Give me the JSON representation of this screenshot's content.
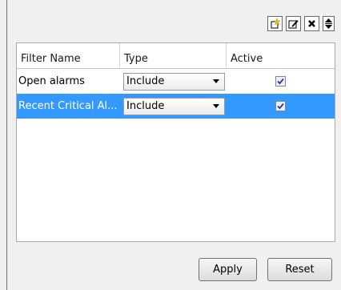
{
  "toolbar": {
    "icons": [
      "new-filter-icon",
      "edit-filter-icon",
      "delete-filter-icon",
      "move-up-down-icon"
    ]
  },
  "table": {
    "columns": [
      "Filter Name",
      "Type",
      "Active"
    ],
    "rows": [
      {
        "name": "Open alarms",
        "type": "Include",
        "active": true,
        "selected": false
      },
      {
        "name": "Recent Critical Al...",
        "type": "Include",
        "active": true,
        "selected": true
      }
    ]
  },
  "footer": {
    "apply_label": "Apply",
    "reset_label": "Reset"
  },
  "colors": {
    "selection": "#3399ff",
    "background": "#f0f0f0"
  }
}
